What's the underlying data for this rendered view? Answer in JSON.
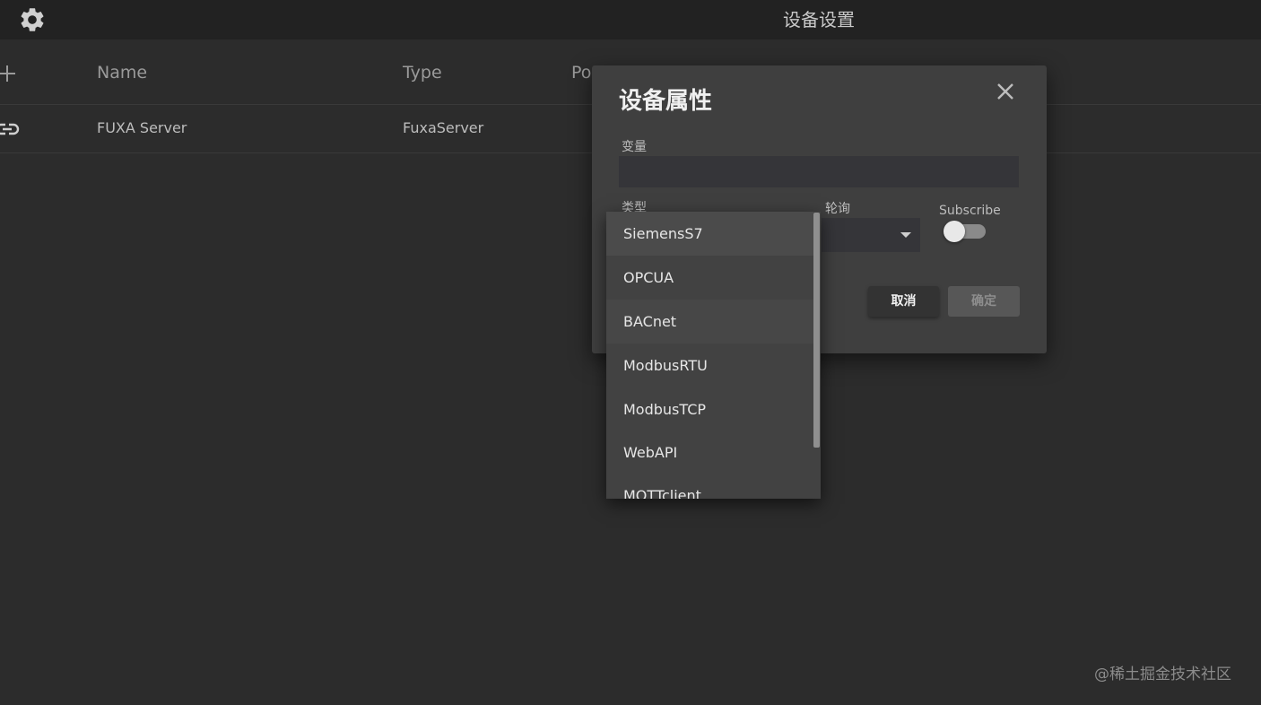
{
  "header": {
    "title": "设备设置",
    "settings_icon": "gear-icon"
  },
  "table": {
    "add_icon": "plus-icon",
    "columns": [
      "Name",
      "Type",
      "Po"
    ],
    "rows": [
      {
        "icon": "link-icon",
        "name": "FUXA Server",
        "type": "FuxaServer"
      }
    ]
  },
  "dialog": {
    "title": "设备属性",
    "close_icon": "close-icon",
    "name_label": "变量",
    "name_value": "",
    "type_label": "类型",
    "polling_label": "轮询",
    "subscribe_label": "Subscribe",
    "subscribe_on": false,
    "cancel_label": "取消",
    "ok_label": "确定"
  },
  "type_dropdown": {
    "options": [
      "SiemensS7",
      "OPCUA",
      "BACnet",
      "ModbusRTU",
      "ModbusTCP",
      "WebAPI",
      "MQTTclient"
    ]
  },
  "watermark": "@稀土掘金技术社区",
  "colors": {
    "background": "#2c2c2c",
    "topbar": "#222222",
    "dialog": "#3f3f3f",
    "dropdown": "#424242"
  }
}
